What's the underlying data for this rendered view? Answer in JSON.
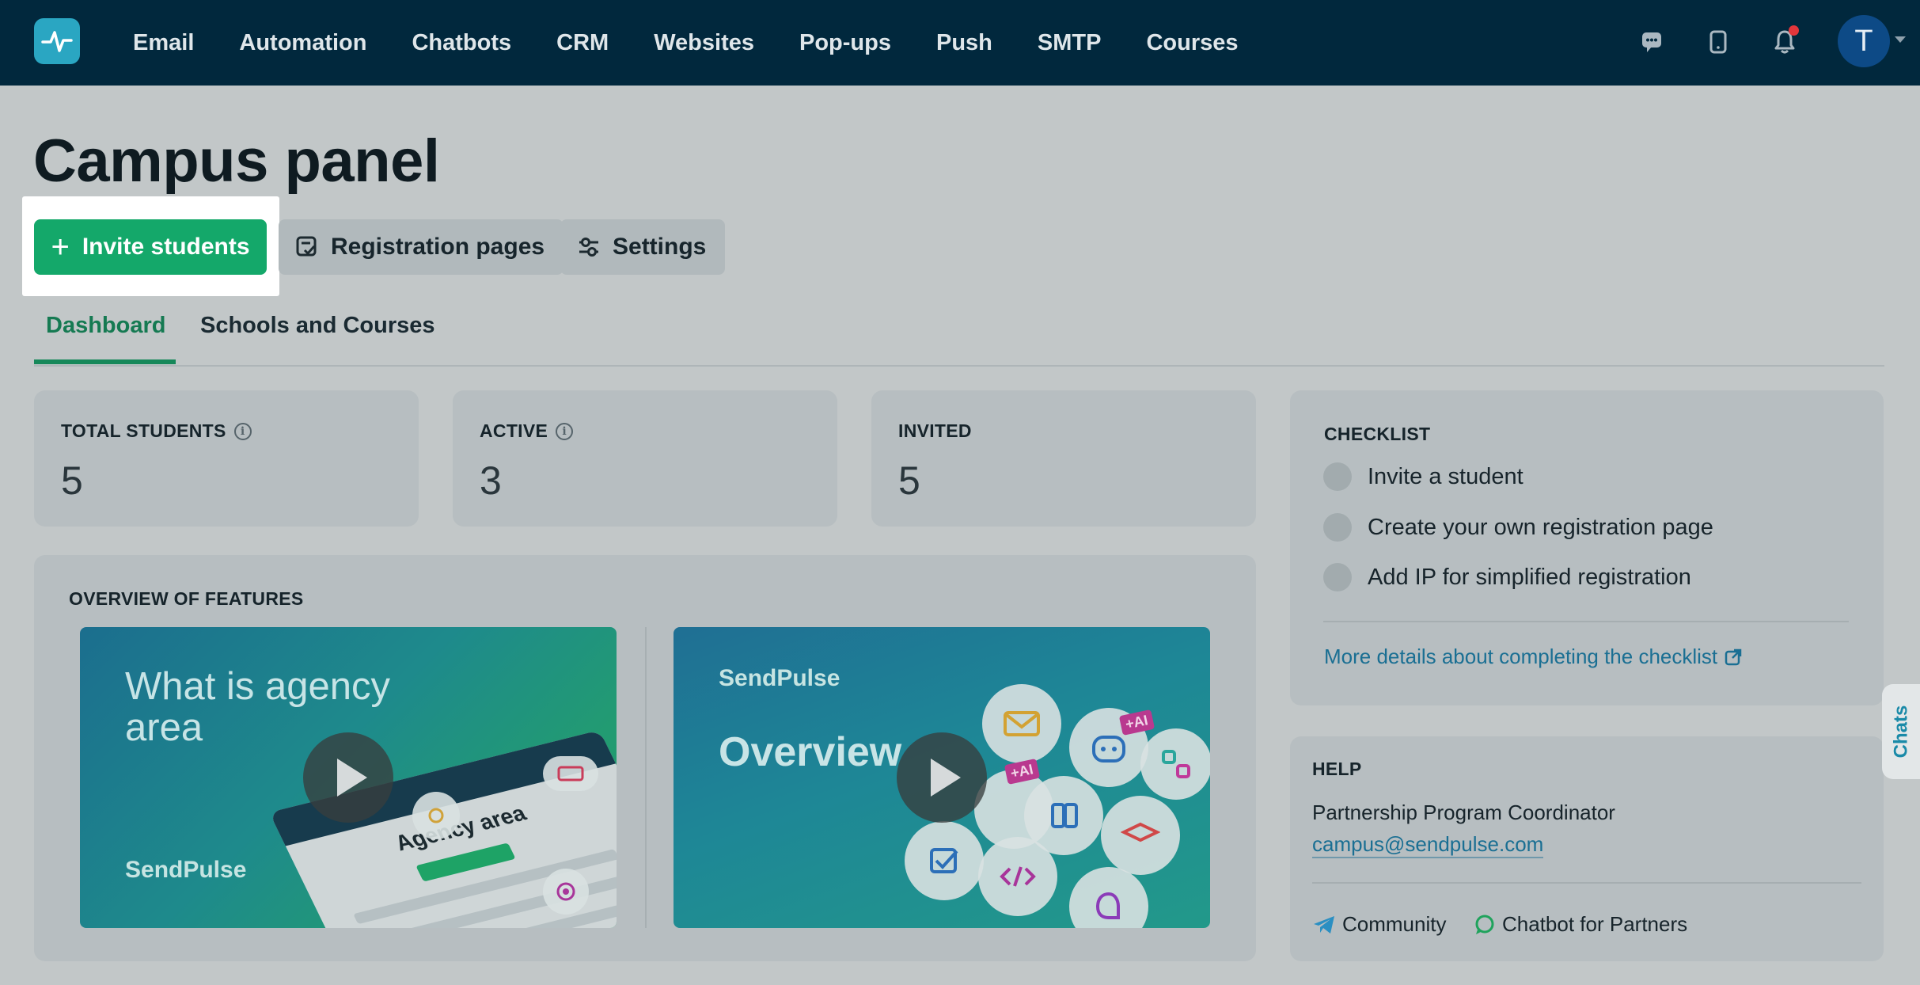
{
  "nav": {
    "items": [
      "Email",
      "Automation",
      "Chatbots",
      "CRM",
      "Websites",
      "Pop-ups",
      "Push",
      "SMTP",
      "Courses"
    ],
    "avatar_letter": "T"
  },
  "page": {
    "title": "Campus panel",
    "actions": {
      "invite": "Invite students",
      "registration": "Registration pages",
      "settings": "Settings"
    },
    "tabs": [
      "Dashboard",
      "Schools and Courses"
    ]
  },
  "stats": [
    {
      "label": "TOTAL STUDENTS",
      "value": "5"
    },
    {
      "label": "ACTIVE",
      "value": "3"
    },
    {
      "label": "INVITED",
      "value": "5"
    }
  ],
  "features": {
    "title": "OVERVIEW OF FEATURES",
    "video1": {
      "title": "What is agency area",
      "logo": "SendPulse",
      "mockup_title": "Agency area"
    },
    "video2": {
      "logo": "SendPulse",
      "word": "Overview",
      "tag": "+AI"
    }
  },
  "checklist": {
    "title": "CHECKLIST",
    "items": [
      "Invite a student",
      "Create your own registration page",
      "Add IP for simplified registration"
    ],
    "more_link": "More details about completing the checklist"
  },
  "help": {
    "title": "HELP",
    "role": "Partnership Program Coordinator",
    "email": "campus@sendpulse.com",
    "community": "Community",
    "chatbot": "Chatbot for Partners"
  },
  "chats_tab": "Chats",
  "colors": {
    "nav_bg": "#01283d",
    "primary": "#14a86a",
    "tab_active": "#157a52",
    "link": "#1a6f93"
  }
}
